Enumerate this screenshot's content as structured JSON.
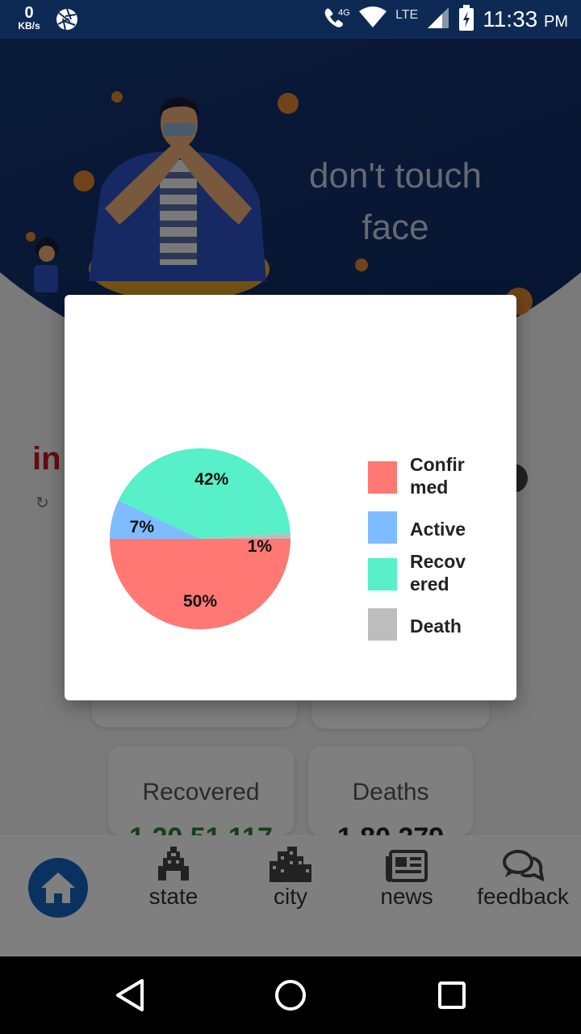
{
  "status_bar": {
    "speed_value": "0",
    "speed_unit": "KB/s",
    "network": "4G",
    "lte": "LTE",
    "time": "11:33",
    "ampm": "PM"
  },
  "hero": {
    "line1": "don't touch",
    "line2": "face"
  },
  "background": {
    "title_partial": "in",
    "cards": [
      {
        "title": "Recovered",
        "value": "1,20,51,117",
        "color": "#2e7d32"
      },
      {
        "title": "Deaths",
        "value": "1,80,279",
        "color": "#222222"
      }
    ]
  },
  "bottom_nav": {
    "items": [
      {
        "label": "state",
        "icon": "temple-icon"
      },
      {
        "label": "city",
        "icon": "city-icon"
      },
      {
        "label": "news",
        "icon": "newspaper-icon"
      },
      {
        "label": "feedback",
        "icon": "chat-icon"
      }
    ],
    "home_icon": "home-icon",
    "home_color": "#1565c0"
  },
  "chart_data": {
    "type": "pie",
    "slices": [
      {
        "label": "Confirmed",
        "value": 50,
        "display": "50%",
        "color": "#ff7873"
      },
      {
        "label": "Active",
        "value": 7,
        "display": "7%",
        "color": "#7fbcff"
      },
      {
        "label": "Recovered",
        "value": 42,
        "display": "42%",
        "color": "#57f0c8"
      },
      {
        "label": "Death",
        "value": 1,
        "display": "1%",
        "color": "#bdbdbd"
      }
    ],
    "legend": [
      "Confir med",
      "Active",
      "Recov ered",
      "Death"
    ],
    "legend_position": "right"
  }
}
